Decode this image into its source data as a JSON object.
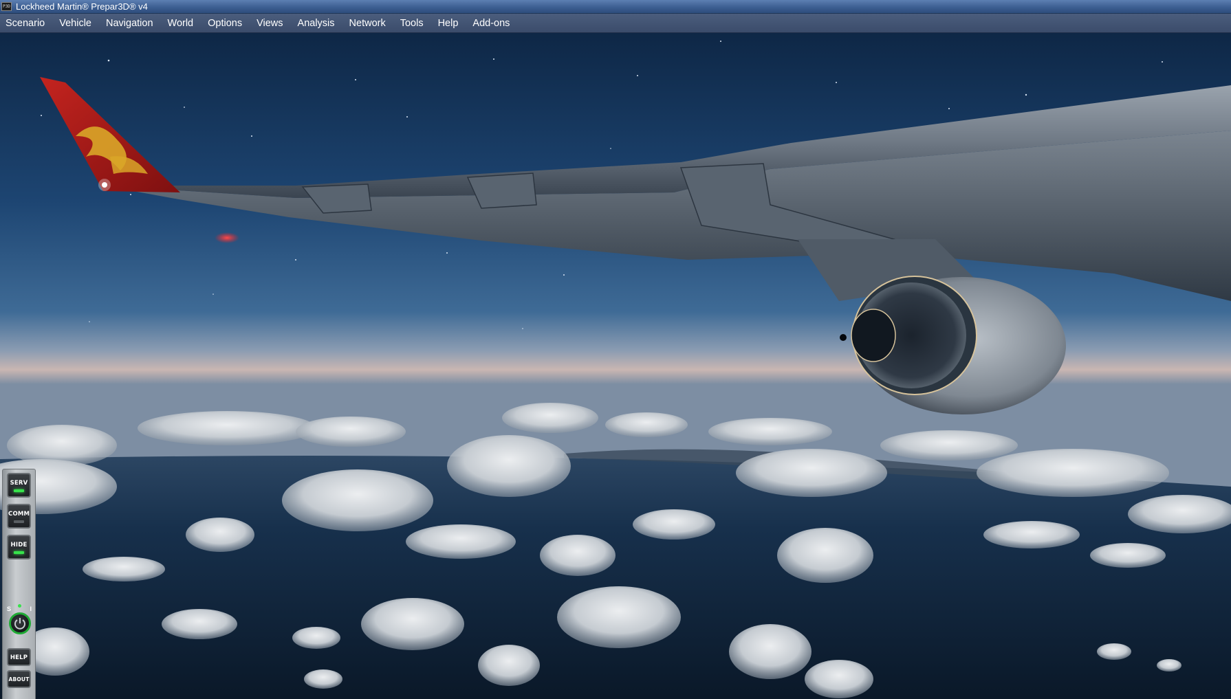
{
  "window": {
    "title": "Lockheed Martin® Prepar3D® v4",
    "app_icon_text": "P3D"
  },
  "menu": {
    "items": [
      {
        "label": "Scenario",
        "name": "menu-scenario"
      },
      {
        "label": "Vehicle",
        "name": "menu-vehicle"
      },
      {
        "label": "Navigation",
        "name": "menu-navigation"
      },
      {
        "label": "World",
        "name": "menu-world"
      },
      {
        "label": "Options",
        "name": "menu-options"
      },
      {
        "label": "Views",
        "name": "menu-views"
      },
      {
        "label": "Analysis",
        "name": "menu-analysis"
      },
      {
        "label": "Network",
        "name": "menu-network"
      },
      {
        "label": "Tools",
        "name": "menu-tools"
      },
      {
        "label": "Help",
        "name": "menu-help"
      },
      {
        "label": "Add-ons",
        "name": "menu-add-ons"
      }
    ]
  },
  "side_panel": {
    "serv": {
      "label": "SERV",
      "led": "on"
    },
    "comm": {
      "label": "COMM",
      "led": "off"
    },
    "hide": {
      "label": "HIDE",
      "led": "on"
    },
    "knob": {
      "left_label": "S",
      "right_label": "I"
    },
    "help": {
      "label": "HELP"
    },
    "about": {
      "label": "ABOUT"
    }
  },
  "colors": {
    "sky_top": "#0e2746",
    "sky_mid": "#2a5a8c",
    "horizon_glow": "#c9b6b2",
    "sea": "#0f2238",
    "tail": "#b01a1a",
    "tail_logo": "#d9a628",
    "led_green": "#37e24b"
  }
}
